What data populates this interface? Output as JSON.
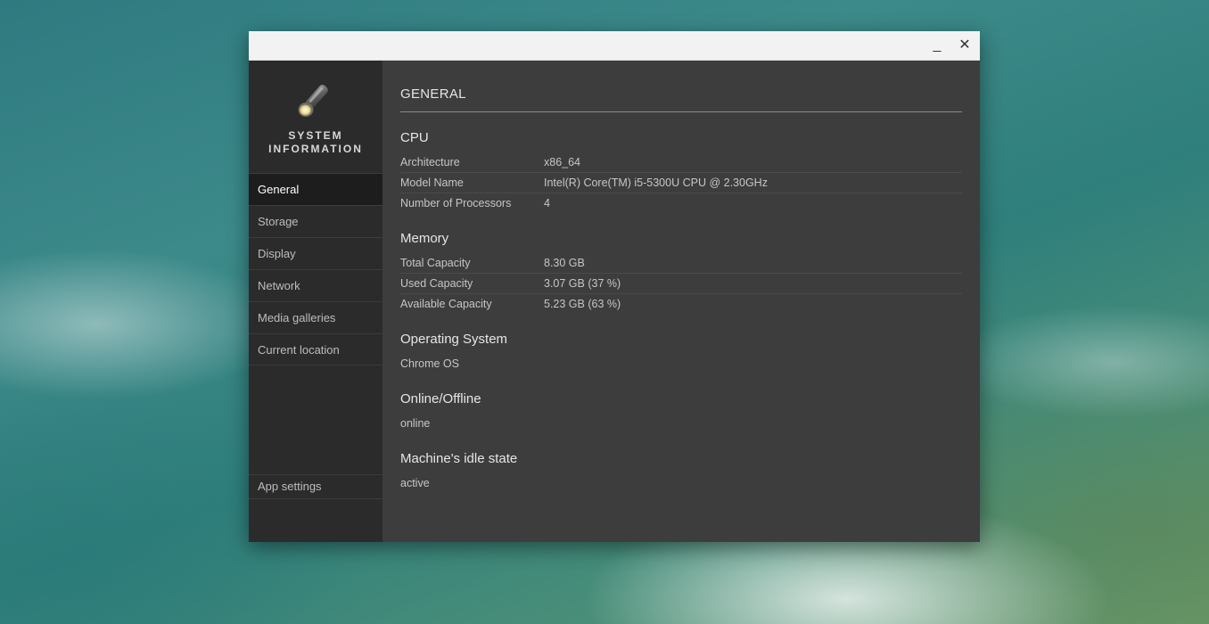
{
  "window": {
    "minimize_glyph": "_",
    "close_glyph": "✕"
  },
  "sidebar": {
    "brand_line1": "SYSTEM",
    "brand_line2": "INFORMATION",
    "items": [
      {
        "label": "General",
        "active": true
      },
      {
        "label": "Storage"
      },
      {
        "label": "Display"
      },
      {
        "label": "Network"
      },
      {
        "label": "Media galleries"
      },
      {
        "label": "Current location"
      }
    ],
    "app_settings_label": "App settings"
  },
  "main": {
    "title": "GENERAL",
    "cpu": {
      "heading": "CPU",
      "rows": [
        {
          "key": "Architecture",
          "value": "x86_64"
        },
        {
          "key": "Model Name",
          "value": "Intel(R) Core(TM) i5-5300U CPU @ 2.30GHz"
        },
        {
          "key": "Number of Processors",
          "value": "4"
        }
      ]
    },
    "memory": {
      "heading": "Memory",
      "rows": [
        {
          "key": "Total Capacity",
          "value": "8.30 GB"
        },
        {
          "key": "Used Capacity",
          "value": "3.07 GB (37 %)"
        },
        {
          "key": "Available Capacity",
          "value": "5.23 GB (63 %)"
        }
      ]
    },
    "os": {
      "heading": "Operating System",
      "value": "Chrome OS"
    },
    "online": {
      "heading": "Online/Offline",
      "value": "online"
    },
    "idle": {
      "heading": "Machine's idle state",
      "value": "active"
    }
  },
  "colors": {
    "sidebar_bg": "#2b2b2b",
    "content_bg": "#3d3d3d",
    "active_item_bg": "#1d1d1d",
    "titlebar_bg": "#f2f2f2"
  },
  "icons": {
    "app_logo": "flashlight-icon",
    "minimize": "minimize-icon",
    "close": "close-icon"
  }
}
